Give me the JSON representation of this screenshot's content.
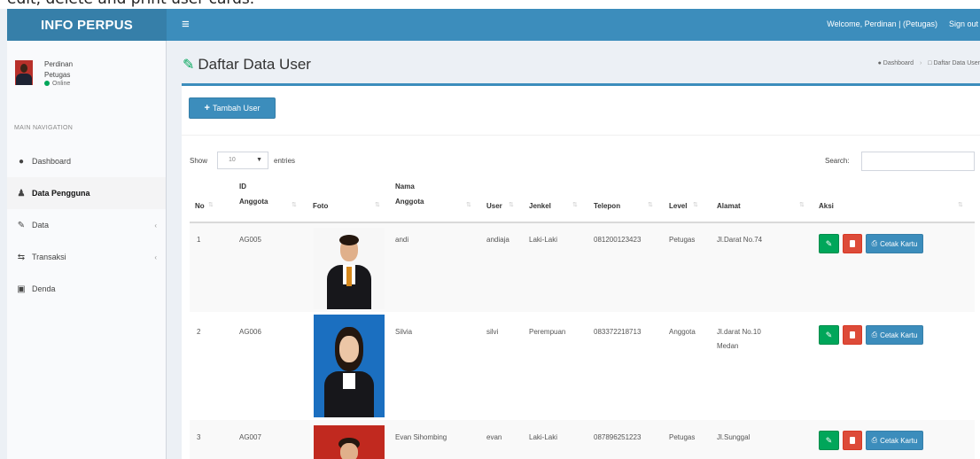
{
  "caption": "edit, delete and print user cards.",
  "header": {
    "logo": "INFO PERPUS",
    "menu_icon": "≡",
    "welcome": "Welcome, Perdinan | (Petugas)",
    "signout": "Sign out"
  },
  "sidebar": {
    "user_name": "Perdinan",
    "user_role": "Petugas",
    "user_status": "Online",
    "nav_header": "MAIN NAVIGATION",
    "items": [
      {
        "label": "Dashboard",
        "icon": "dashboard-icon"
      },
      {
        "label": "Data Pengguna",
        "icon": "user-icon"
      },
      {
        "label": "Data",
        "icon": "edit-icon"
      },
      {
        "label": "Transaksi",
        "icon": "exchange-icon"
      },
      {
        "label": "Denda",
        "icon": "calendar-icon"
      }
    ]
  },
  "content": {
    "title": "Daftar Data User",
    "breadcrumb": [
      "Dashboard",
      "Daftar Data User"
    ]
  },
  "toolbar": {
    "add_label": "Tambah User"
  },
  "table_controls": {
    "show_label": "Show",
    "entries_value": "10",
    "entries_label": "entries",
    "search_label": "Search:"
  },
  "table": {
    "headers": {
      "no": "No",
      "id_line1": "ID",
      "id_line2": "Anggota",
      "foto": "Foto",
      "nama_line1": "Nama",
      "nama_line2": "Anggota",
      "user": "User",
      "jenkel": "Jenkel",
      "telepon": "Telepon",
      "level": "Level",
      "alamat": "Alamat",
      "aksi": "Aksi"
    },
    "rows": [
      {
        "no": "1",
        "id": "AG005",
        "nama": "andi",
        "user": "andiaja",
        "jenkel": "Laki-Laki",
        "telepon": "081200123423",
        "level": "Petugas",
        "alamat_line1": "Jl.Darat No.74",
        "alamat_line2": ""
      },
      {
        "no": "2",
        "id": "AG006",
        "nama": "Silvia",
        "user": "silvi",
        "jenkel": "Perempuan",
        "telepon": "083372218713",
        "level": "Anggota",
        "alamat_line1": "Jl.darat No.10",
        "alamat_line2": "Medan"
      },
      {
        "no": "3",
        "id": "AG007",
        "nama": "Evan Sihombing",
        "user": "evan",
        "jenkel": "Laki-Laki",
        "telepon": "087896251223",
        "level": "Petugas",
        "alamat_line1": "Jl.Sunggal",
        "alamat_line2": ""
      }
    ],
    "actions": {
      "print_label": "Cetak Kartu"
    }
  }
}
